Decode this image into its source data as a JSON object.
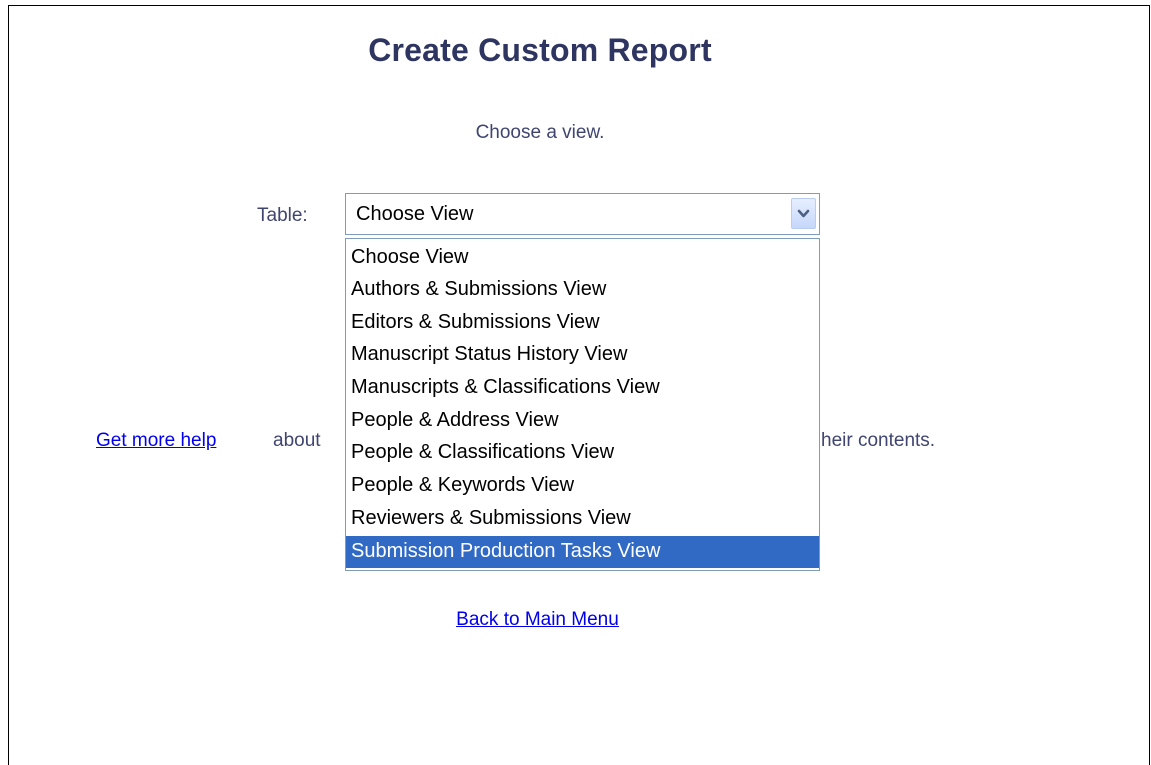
{
  "page": {
    "title": "Create Custom Report",
    "instruction": "Choose a view."
  },
  "table_select": {
    "label": "Table:",
    "value": "Choose View",
    "options": [
      "Choose View",
      "Authors & Submissions View",
      "Editors & Submissions View",
      "Manuscript Status History View",
      "Manuscripts & Classifications View",
      "People & Address View",
      "People & Classifications View",
      "People & Keywords View",
      "Reviewers & Submissions View",
      "Submission Production Tasks View"
    ],
    "highlighted_option": "Submission Production Tasks View"
  },
  "help": {
    "link_text": "Get more help",
    "about_text": "about",
    "tail_text": "heir contents."
  },
  "footer": {
    "back_link": "Back to Main Menu"
  },
  "colors": {
    "text": "#3f4570",
    "title": "#2e3560",
    "link": "#0000ee",
    "highlight": "#316ac5",
    "select_border": "#7f9db9"
  },
  "icons": {
    "dropdown_arrow": "chevron-down-icon"
  }
}
